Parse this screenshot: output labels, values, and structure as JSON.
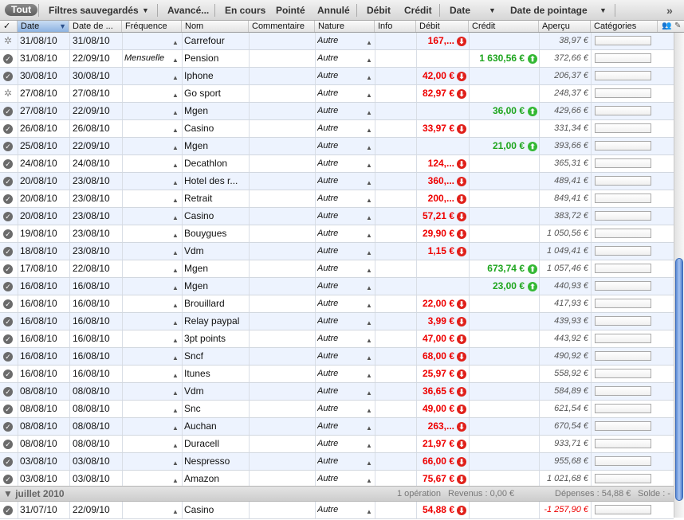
{
  "filters": {
    "tout": "Tout",
    "saved": "Filtres sauvegardés",
    "advanced": "Avancé...",
    "en_cours": "En cours",
    "pointe": "Pointé",
    "annule": "Annulé",
    "debit": "Débit",
    "credit": "Crédit",
    "date": "Date",
    "date_pointage": "Date de pointage",
    "more": "»"
  },
  "columns": {
    "check": "✓",
    "date": "Date",
    "date_value": "Date de ...",
    "frequency": "Fréquence",
    "name": "Nom",
    "comment": "Commentaire",
    "nature": "Nature",
    "info": "Info",
    "debit": "Débit",
    "credit": "Crédit",
    "preview": "Aperçu",
    "categories": "Catégories"
  },
  "icons": {
    "checked": "check-circle-icon",
    "pending": "spinner-icon",
    "debit": "arrow-down-icon",
    "credit": "arrow-up-icon"
  },
  "colors": {
    "debit": "#e00000",
    "credit": "#1ea51e",
    "selected_header": "#8db3e2",
    "row_alt": "#edf3fe"
  },
  "transactions": [
    {
      "status": "pending",
      "date": "31/08/10",
      "date_value": "31/08/10",
      "frequency": "",
      "name": "Carrefour",
      "nature": "Autre",
      "debit": "167,...",
      "credit": "",
      "preview": "38,97 €"
    },
    {
      "status": "checked",
      "date": "31/08/10",
      "date_value": "22/09/10",
      "frequency": "Mensuelle",
      "name": "Pension",
      "nature": "Autre",
      "debit": "",
      "credit": "1 630,56 €",
      "preview": "372,66 €"
    },
    {
      "status": "checked",
      "date": "30/08/10",
      "date_value": "30/08/10",
      "frequency": "",
      "name": "Iphone",
      "nature": "Autre",
      "debit": "42,00 €",
      "credit": "",
      "preview": "206,37 €"
    },
    {
      "status": "pending",
      "date": "27/08/10",
      "date_value": "27/08/10",
      "frequency": "",
      "name": "Go sport",
      "nature": "Autre",
      "debit": "82,97 €",
      "credit": "",
      "preview": "248,37 €"
    },
    {
      "status": "checked",
      "date": "27/08/10",
      "date_value": "22/09/10",
      "frequency": "",
      "name": "Mgen",
      "nature": "Autre",
      "debit": "",
      "credit": "36,00 €",
      "preview": "429,66 €"
    },
    {
      "status": "checked",
      "date": "26/08/10",
      "date_value": "26/08/10",
      "frequency": "",
      "name": "Casino",
      "nature": "Autre",
      "debit": "33,97 €",
      "credit": "",
      "preview": "331,34 €"
    },
    {
      "status": "checked",
      "date": "25/08/10",
      "date_value": "22/09/10",
      "frequency": "",
      "name": "Mgen",
      "nature": "Autre",
      "debit": "",
      "credit": "21,00 €",
      "preview": "393,66 €"
    },
    {
      "status": "checked",
      "date": "24/08/10",
      "date_value": "24/08/10",
      "frequency": "",
      "name": "Decathlon",
      "nature": "Autre",
      "debit": "124,...",
      "credit": "",
      "preview": "365,31 €"
    },
    {
      "status": "checked",
      "date": "20/08/10",
      "date_value": "23/08/10",
      "frequency": "",
      "name": "Hotel des r...",
      "nature": "Autre",
      "debit": "360,...",
      "credit": "",
      "preview": "489,41 €"
    },
    {
      "status": "checked",
      "date": "20/08/10",
      "date_value": "23/08/10",
      "frequency": "",
      "name": "Retrait",
      "nature": "Autre",
      "debit": "200,...",
      "credit": "",
      "preview": "849,41 €"
    },
    {
      "status": "checked",
      "date": "20/08/10",
      "date_value": "23/08/10",
      "frequency": "",
      "name": "Casino",
      "nature": "Autre",
      "debit": "57,21 €",
      "credit": "",
      "preview": "383,72 €"
    },
    {
      "status": "checked",
      "date": "19/08/10",
      "date_value": "23/08/10",
      "frequency": "",
      "name": "Bouygues",
      "nature": "Autre",
      "debit": "29,90 €",
      "credit": "",
      "preview": "1 050,56 €"
    },
    {
      "status": "checked",
      "date": "18/08/10",
      "date_value": "23/08/10",
      "frequency": "",
      "name": "Vdm",
      "nature": "Autre",
      "debit": "1,15 €",
      "credit": "",
      "preview": "1 049,41 €"
    },
    {
      "status": "checked",
      "date": "17/08/10",
      "date_value": "22/08/10",
      "frequency": "",
      "name": "Mgen",
      "nature": "Autre",
      "debit": "",
      "credit": "673,74 €",
      "preview": "1 057,46 €"
    },
    {
      "status": "checked",
      "date": "16/08/10",
      "date_value": "16/08/10",
      "frequency": "",
      "name": "Mgen",
      "nature": "Autre",
      "debit": "",
      "credit": "23,00 €",
      "preview": "440,93 €"
    },
    {
      "status": "checked",
      "date": "16/08/10",
      "date_value": "16/08/10",
      "frequency": "",
      "name": "Brouillard",
      "nature": "Autre",
      "debit": "22,00 €",
      "credit": "",
      "preview": "417,93 €"
    },
    {
      "status": "checked",
      "date": "16/08/10",
      "date_value": "16/08/10",
      "frequency": "",
      "name": "Relay paypal",
      "nature": "Autre",
      "debit": "3,99 €",
      "credit": "",
      "preview": "439,93 €"
    },
    {
      "status": "checked",
      "date": "16/08/10",
      "date_value": "16/08/10",
      "frequency": "",
      "name": "3pt points",
      "nature": "Autre",
      "debit": "47,00 €",
      "credit": "",
      "preview": "443,92 €"
    },
    {
      "status": "checked",
      "date": "16/08/10",
      "date_value": "16/08/10",
      "frequency": "",
      "name": "Sncf",
      "nature": "Autre",
      "debit": "68,00 €",
      "credit": "",
      "preview": "490,92 €"
    },
    {
      "status": "checked",
      "date": "16/08/10",
      "date_value": "16/08/10",
      "frequency": "",
      "name": "Itunes",
      "nature": "Autre",
      "debit": "25,97 €",
      "credit": "",
      "preview": "558,92 €"
    },
    {
      "status": "checked",
      "date": "08/08/10",
      "date_value": "08/08/10",
      "frequency": "",
      "name": "Vdm",
      "nature": "Autre",
      "debit": "36,65 €",
      "credit": "",
      "preview": "584,89 €"
    },
    {
      "status": "checked",
      "date": "08/08/10",
      "date_value": "08/08/10",
      "frequency": "",
      "name": "Snc",
      "nature": "Autre",
      "debit": "49,00 €",
      "credit": "",
      "preview": "621,54 €"
    },
    {
      "status": "checked",
      "date": "08/08/10",
      "date_value": "08/08/10",
      "frequency": "",
      "name": "Auchan",
      "nature": "Autre",
      "debit": "263,...",
      "credit": "",
      "preview": "670,54 €"
    },
    {
      "status": "checked",
      "date": "08/08/10",
      "date_value": "08/08/10",
      "frequency": "",
      "name": "Duracell",
      "nature": "Autre",
      "debit": "21,97 €",
      "credit": "",
      "preview": "933,71 €"
    },
    {
      "status": "checked",
      "date": "03/08/10",
      "date_value": "03/08/10",
      "frequency": "",
      "name": "Nespresso",
      "nature": "Autre",
      "debit": "66,00 €",
      "credit": "",
      "preview": "955,68 €"
    },
    {
      "status": "checked",
      "date": "03/08/10",
      "date_value": "03/08/10",
      "frequency": "",
      "name": "Amazon",
      "nature": "Autre",
      "debit": "75,67 €",
      "credit": "",
      "preview": "1 021,68 €"
    }
  ],
  "group": {
    "title": "juillet 2010",
    "operations": "1 opération",
    "revenus": "Revenus : 0,00 €",
    "depenses": "Dépenses : 54,88 €",
    "solde": "Solde : -"
  },
  "last_row": {
    "status": "checked",
    "date": "31/07/10",
    "date_value": "22/09/10",
    "frequency": "",
    "name": "Casino",
    "nature": "Autre",
    "debit": "54,88 €",
    "credit": "",
    "preview": "-1 257,90 €",
    "negative": true
  }
}
